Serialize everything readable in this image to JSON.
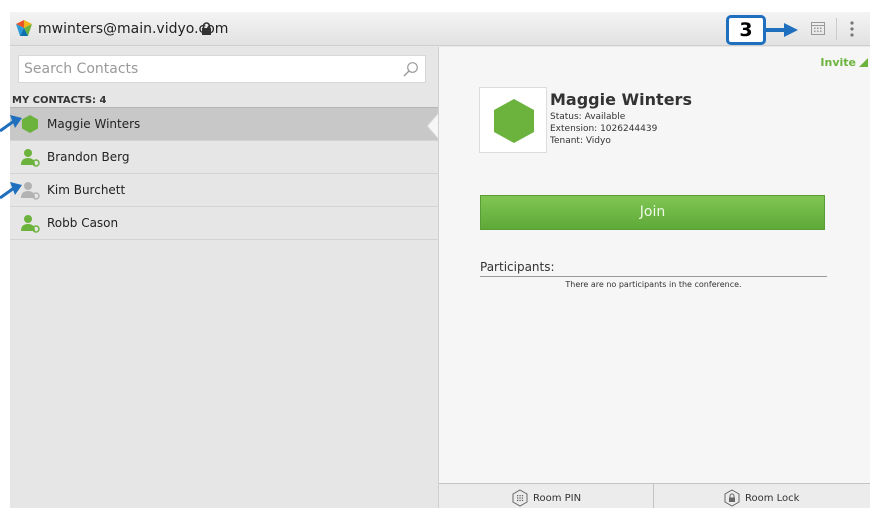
{
  "titlebar": {
    "account": "mwinters@main.vidyo.com",
    "callout_number": "3"
  },
  "contacts": {
    "search_placeholder": "Search Contacts",
    "header": "MY CONTACTS: 4",
    "items": [
      {
        "name": "Maggie Winters",
        "status": "available",
        "selected": true
      },
      {
        "name": "Brandon Berg",
        "status": "available",
        "selected": false
      },
      {
        "name": "Kim Burchett",
        "status": "offline",
        "selected": false
      },
      {
        "name": "Robb Cason",
        "status": "available",
        "selected": false
      }
    ]
  },
  "detail": {
    "invite_label": "Invite",
    "name": "Maggie Winters",
    "status_line": "Status: Available",
    "extension_line": "Extension: 1026244439",
    "tenant_line": "Tenant: Vidyo",
    "join_label": "Join",
    "participants_title": "Participants:",
    "participants_empty": "There are no participants in the conference."
  },
  "bottombar": {
    "room_pin_label": "Room PIN",
    "room_lock_label": "Room Lock"
  },
  "colors": {
    "accent_green": "#6cb33e",
    "callout_blue": "#1f6fbf"
  }
}
